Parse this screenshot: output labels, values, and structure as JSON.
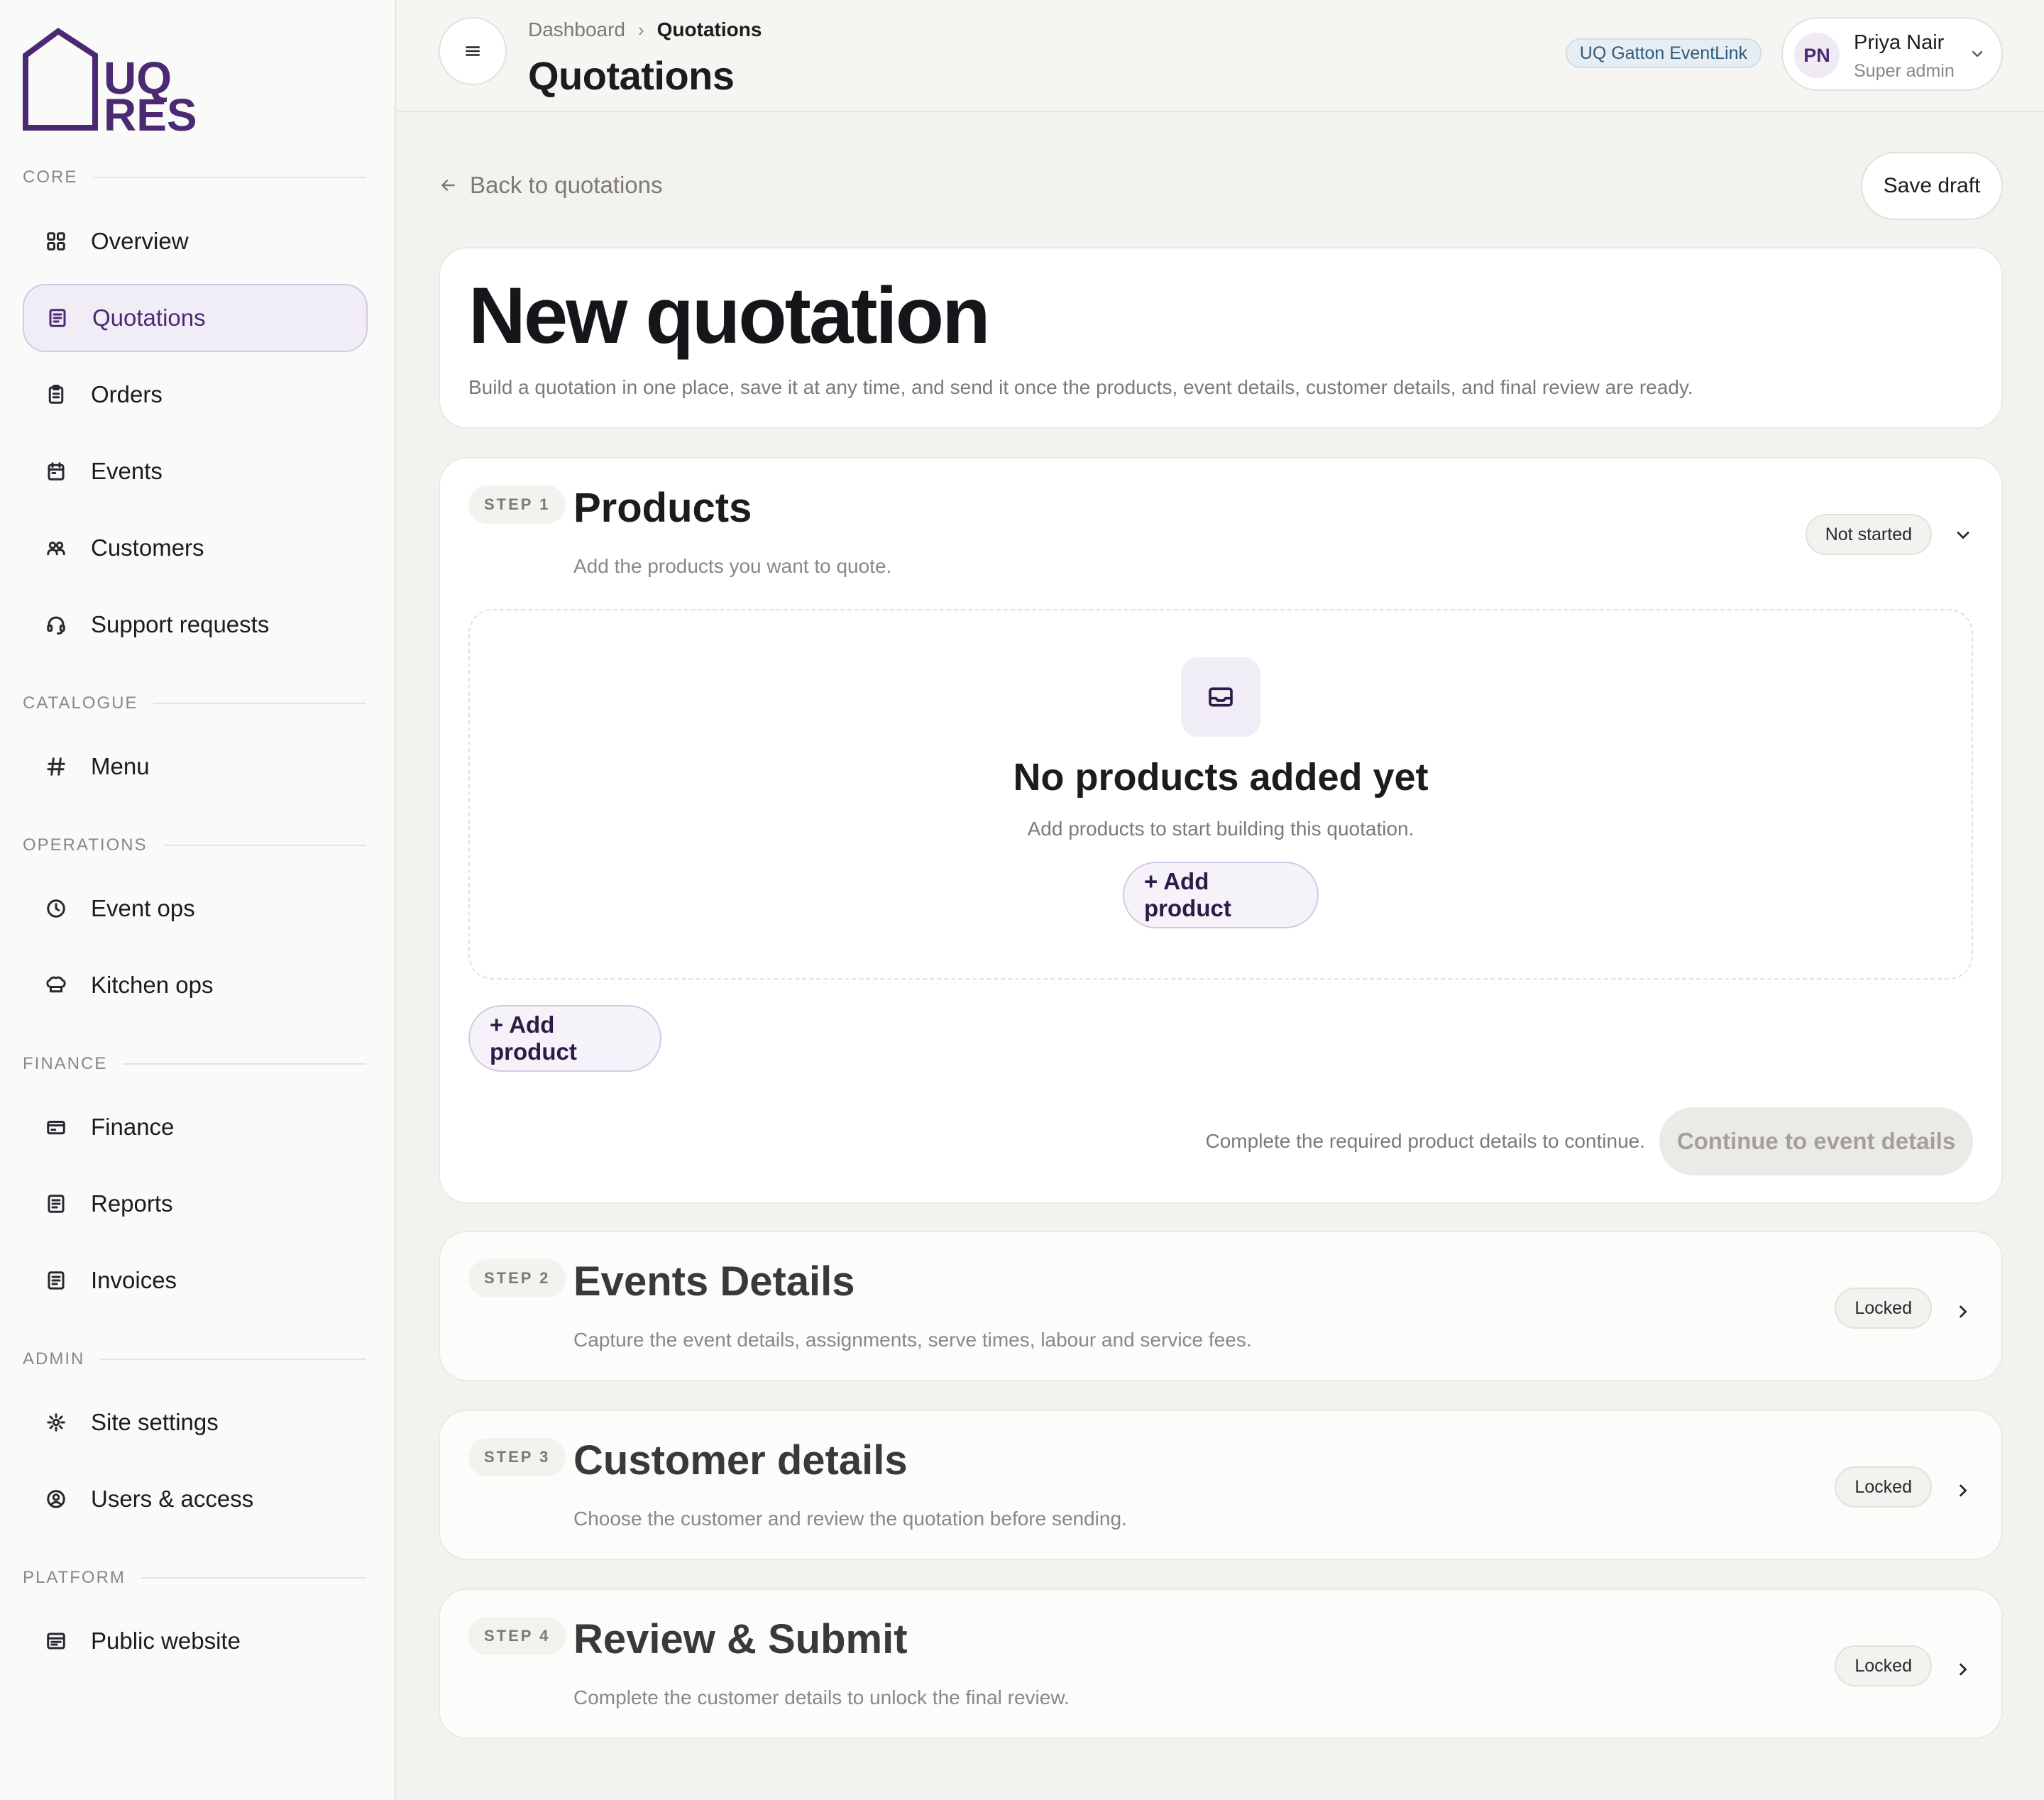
{
  "brand": {
    "logo_line1": "UQ",
    "logo_line2": "RES",
    "color": "#4b2a73"
  },
  "sidebar": {
    "sections": [
      {
        "label": "CORE"
      },
      {
        "label": "CATALOGUE"
      },
      {
        "label": "OPERATIONS"
      },
      {
        "label": "FINANCE"
      },
      {
        "label": "ADMIN"
      },
      {
        "label": "PLATFORM"
      }
    ],
    "items": [
      {
        "label": "Overview",
        "icon": "grid-icon"
      },
      {
        "label": "Quotations",
        "icon": "document-list-icon",
        "active": true
      },
      {
        "label": "Orders",
        "icon": "clipboard-icon"
      },
      {
        "label": "Events",
        "icon": "calendar-icon"
      },
      {
        "label": "Customers",
        "icon": "users-icon"
      },
      {
        "label": "Support requests",
        "icon": "headset-icon"
      },
      {
        "label": "Menu",
        "icon": "hash-icon"
      },
      {
        "label": "Event ops",
        "icon": "clock-icon"
      },
      {
        "label": "Kitchen ops",
        "icon": "chef-hat-icon"
      },
      {
        "label": "Finance",
        "icon": "credit-card-icon"
      },
      {
        "label": "Reports",
        "icon": "report-icon"
      },
      {
        "label": "Invoices",
        "icon": "invoice-icon"
      },
      {
        "label": "Site settings",
        "icon": "gear-icon"
      },
      {
        "label": "Users & access",
        "icon": "user-circle-icon"
      },
      {
        "label": "Public website",
        "icon": "browser-icon"
      }
    ]
  },
  "header": {
    "breadcrumb": [
      "Dashboard",
      "Quotations"
    ],
    "title": "Quotations",
    "tenant": "UQ Gatton EventLink",
    "user": {
      "initials": "PN",
      "name": "Priya Nair",
      "role": "Super admin"
    }
  },
  "main": {
    "back_label": "Back to quotations",
    "save_draft": "Save draft",
    "title": "New quotation",
    "subtitle": "Build a quotation in one place, save it at any time, and send it once the products, event details, customer details, and final review are ready.",
    "steps": [
      {
        "badge": "STEP 1",
        "title": "Products",
        "desc": "Add the products you want to quote.",
        "status": "Not started",
        "empty_title": "No products added yet",
        "empty_desc": "Add products to start building this quotation.",
        "add_label": "+ Add product",
        "continue_hint": "Complete the required product details to continue.",
        "continue_label": "Continue to event details"
      },
      {
        "badge": "STEP 2",
        "title": "Events Details",
        "desc": "Capture the event details, assignments, serve times, labour and service fees.",
        "status": "Locked"
      },
      {
        "badge": "STEP 3",
        "title": "Customer details",
        "desc": "Choose the customer and review the quotation before sending.",
        "status": "Locked"
      },
      {
        "badge": "STEP 4",
        "title": "Review & Submit",
        "desc": "Complete the customer details to unlock the final review.",
        "status": "Locked"
      }
    ]
  }
}
